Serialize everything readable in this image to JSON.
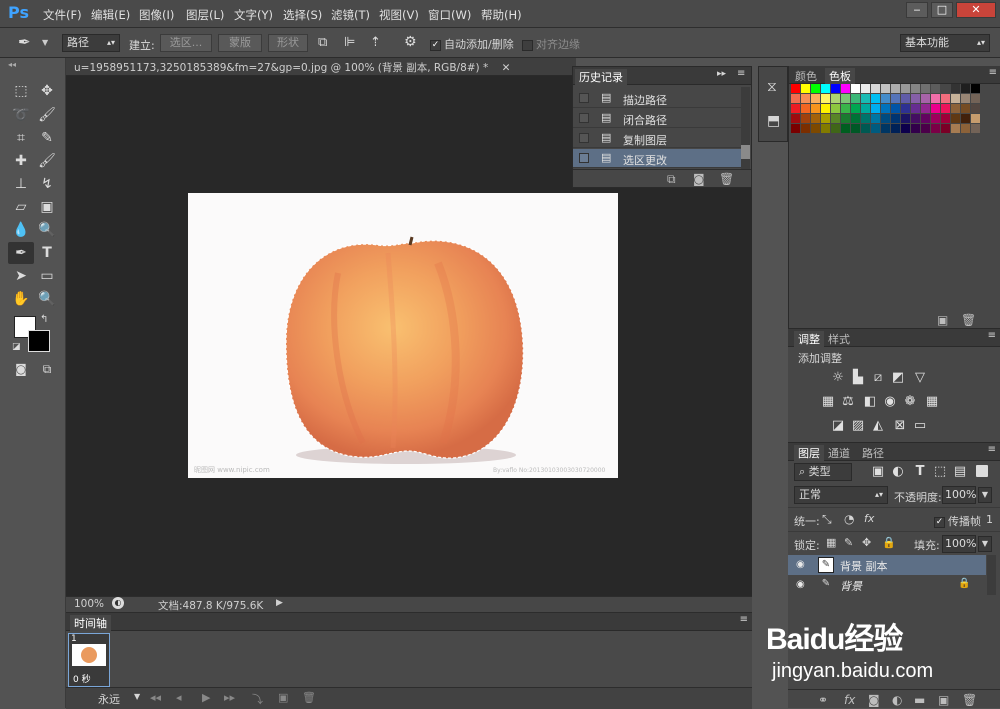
{
  "app": {
    "logo": "Ps"
  },
  "menu": [
    "文件(F)",
    "编辑(E)",
    "图像(I)",
    "图层(L)",
    "文字(Y)",
    "选择(S)",
    "滤镜(T)",
    "视图(V)",
    "窗口(W)",
    "帮助(H)"
  ],
  "window_buttons": [
    "‒",
    "□",
    "✕"
  ],
  "options": {
    "mode": "路径",
    "build_label": "建立:",
    "selection_btn": "选区...",
    "mask_btn": "蒙版",
    "shape_btn": "形状",
    "auto_add_label": "自动添加/删除",
    "auto_add_checked": true,
    "align_edges_label": "对齐边缘",
    "align_edges_checked": false,
    "workspace": "基本功能"
  },
  "document": {
    "tab_title": "u=1958951173,3250185389&fm=27&gp=0.jpg @ 100% (背景 副本, RGB/8#) *",
    "zoom": "100%",
    "doc_size": "文档:487.8 K/975.6K",
    "watermark_left": "昵图网 www.nipic.com",
    "watermark_right": "By:vaflo  No:20130103003030720000"
  },
  "history": {
    "title": "历史记录",
    "items": [
      "描边路径",
      "闭合路径",
      "复制图层",
      "选区更改"
    ],
    "selected_index": 3
  },
  "swatches": {
    "tab_color": "颜色",
    "tab_swatches": "色板",
    "colors": [
      "#ff0000",
      "#ffff00",
      "#00ff00",
      "#00ffff",
      "#0000ff",
      "#ff00ff",
      "#ffffff",
      "#ebebeb",
      "#d6d6d6",
      "#c2c2c2",
      "#adadad",
      "#999999",
      "#858585",
      "#707070",
      "#5c5c5c",
      "#474747",
      "#333333",
      "#1f1f1f",
      "#000000",
      "#f26c4f",
      "#f68e56",
      "#fbaf5d",
      "#fff467",
      "#acd372",
      "#7cc576",
      "#3bb878",
      "#1abbb4",
      "#00bff3",
      "#438ccb",
      "#5574b9",
      "#605ca8",
      "#855fa8",
      "#a763a8",
      "#f06ea9",
      "#f26d7d",
      "#c7b299",
      "#998675",
      "#736357",
      "#ed1c24",
      "#f26522",
      "#f7941d",
      "#fff200",
      "#8dc73f",
      "#39b54a",
      "#00a651",
      "#00a99d",
      "#00aeef",
      "#0072bc",
      "#0054a6",
      "#2e3192",
      "#662d91",
      "#92278f",
      "#ec008c",
      "#ed145b",
      "#8c6239",
      "#754c24",
      "#534741",
      "#9e0b0f",
      "#a0410d",
      "#a3620a",
      "#aba000",
      "#598527",
      "#1a7b30",
      "#007236",
      "#00746b",
      "#0076a3",
      "#004b80",
      "#003471",
      "#1b1464",
      "#440e62",
      "#630460",
      "#9e005d",
      "#9e0039",
      "#603913",
      "#42210b",
      "#c69c6d",
      "#790000",
      "#7b2e00",
      "#7d4900",
      "#827b00",
      "#406618",
      "#005e20",
      "#005826",
      "#005952",
      "#005b7f",
      "#003663",
      "#002157",
      "#0d004c",
      "#32004b",
      "#4b0049",
      "#7b0046",
      "#7a0026",
      "#a67c52",
      "#8c6239",
      "#736357"
    ]
  },
  "adjustments": {
    "tab_adjust": "调整",
    "tab_styles": "样式",
    "add_label": "添加调整"
  },
  "layers": {
    "tab_layers": "图层",
    "tab_channels": "通道",
    "tab_paths": "路径",
    "kind": "类型",
    "blend_mode": "正常",
    "opacity_label": "不透明度:",
    "opacity": "100%",
    "unify_label": "统一:",
    "propagate_label": "传播帧",
    "propagate_value": "1",
    "lock_label": "锁定:",
    "fill_label": "填充:",
    "fill": "100%",
    "items": [
      {
        "name": "背景 副本",
        "selected": true,
        "locked": false
      },
      {
        "name": "背景",
        "selected": false,
        "locked": true
      }
    ]
  },
  "timeline": {
    "title": "时间轴",
    "frame_number": "1",
    "frame_delay": "0 秒",
    "loop": "永远"
  },
  "watermark": {
    "brand": "Baidu经验",
    "url": "jingyan.baidu.com"
  }
}
